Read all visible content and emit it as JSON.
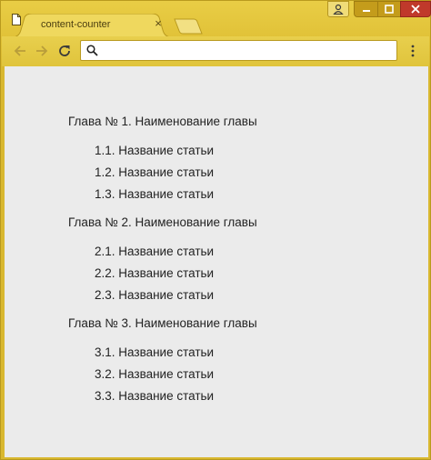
{
  "browser": {
    "tab_title": "content-counter",
    "tab_close_glyph": "×",
    "address_value": "",
    "icons": [
      "user-icon",
      "minimize-icon",
      "maximize-icon",
      "close-icon",
      "document-icon",
      "back-icon",
      "forward-icon",
      "reload-icon",
      "search-icon",
      "menu-icon"
    ],
    "colors": {
      "frame": "#e1c238",
      "close_button": "#c0392b",
      "content_bg": "#ebebeb"
    }
  },
  "content": {
    "chapters": [
      {
        "title": "Глава № 1. Наименование главы",
        "articles": [
          "1.1. Название статьи",
          "1.2. Название статьи",
          "1.3. Название статьи"
        ]
      },
      {
        "title": "Глава № 2. Наименование главы",
        "articles": [
          "2.1. Название статьи",
          "2.2. Название статьи",
          "2.3. Название статьи"
        ]
      },
      {
        "title": "Глава № 3. Наименование главы",
        "articles": [
          "3.1. Название статьи",
          "3.2. Название статьи",
          "3.3. Название статьи"
        ]
      }
    ]
  }
}
